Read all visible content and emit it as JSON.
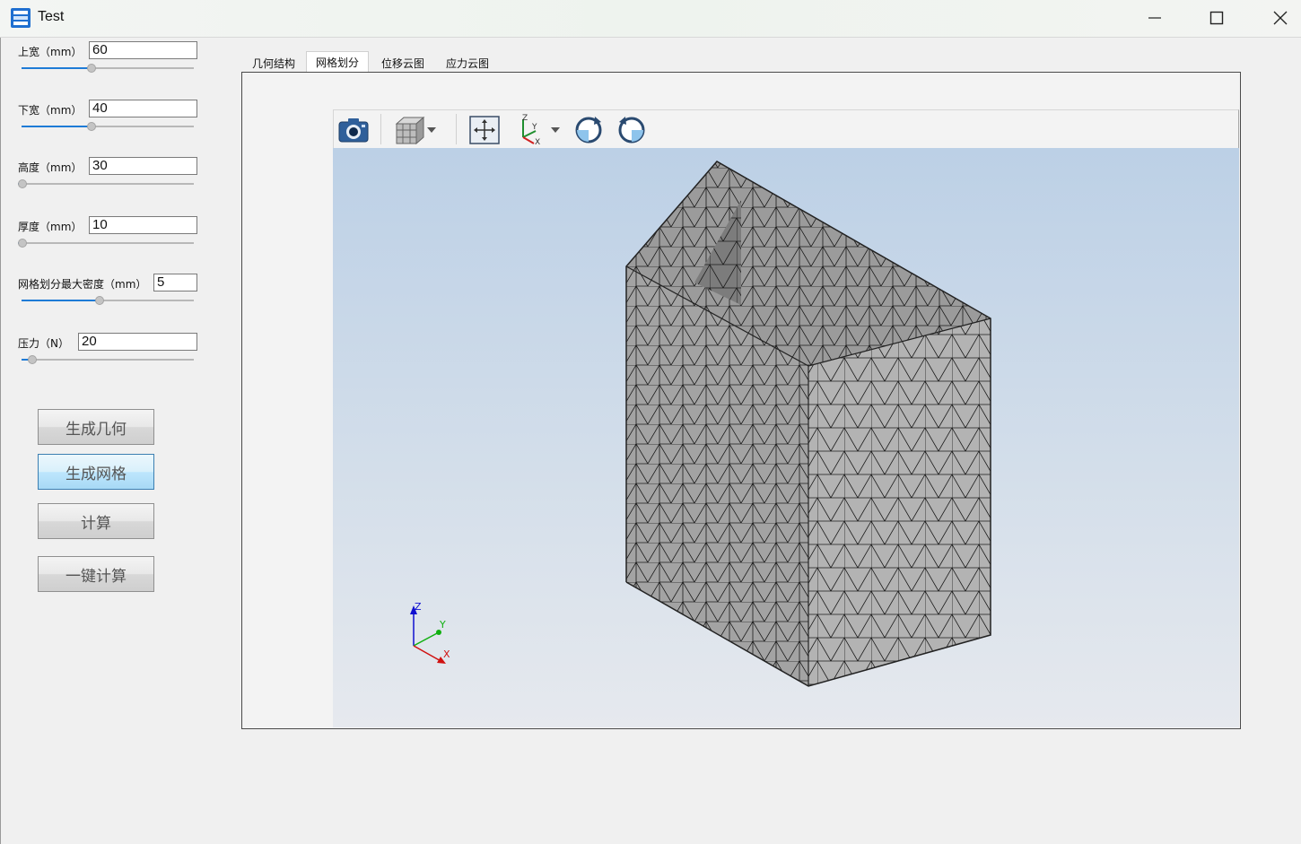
{
  "window": {
    "title": "Test",
    "app_icon": "app-stack-icon",
    "controls": [
      "minimize-icon",
      "maximize-icon",
      "close-icon"
    ]
  },
  "params": [
    {
      "label": "上宽（mm）",
      "value": "60",
      "slider_fraction": 0.4
    },
    {
      "label": "下宽（mm）",
      "value": "40",
      "slider_fraction": 0.4
    },
    {
      "label": "高度（mm）",
      "value": "30",
      "slider_fraction": 0.0
    },
    {
      "label": "厚度（mm）",
      "value": "10",
      "slider_fraction": 0.0
    },
    {
      "label": "网格划分最大密度（mm）",
      "value": "5",
      "slider_fraction": 0.45
    },
    {
      "label": "压力（N）",
      "value": "20",
      "slider_fraction": 0.04
    }
  ],
  "buttons": {
    "generate_geometry": "生成几何",
    "generate_mesh": "生成网格",
    "compute": "计算",
    "one_click_compute": "一键计算"
  },
  "tabs": [
    {
      "label": "几何结构",
      "active": false
    },
    {
      "label": "网格划分",
      "active": true
    },
    {
      "label": "位移云图",
      "active": false
    },
    {
      "label": "应力云图",
      "active": false
    }
  ],
  "viewer_toolbar": [
    "camera-icon",
    "view-cube-icon",
    "dropdown-arrow-icon",
    "fit-all-icon",
    "axes-icon",
    "dropdown-arrow-icon",
    "rotate-cw-icon",
    "rotate-ccw-icon"
  ],
  "axis_triad": {
    "x": "X",
    "y": "Y",
    "z": "Z"
  },
  "colors": {
    "accent": "#1e7bd6",
    "mesh_fill": "#a9a9a9",
    "active_button": "#bee6fd"
  }
}
